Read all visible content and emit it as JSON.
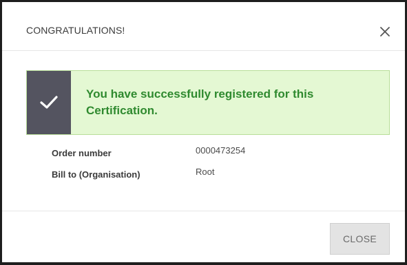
{
  "dialog": {
    "title": "CONGRATULATIONS!",
    "close_icon": "close-icon"
  },
  "alert": {
    "icon": "checkmark-icon",
    "message": "You have successfully registered for this Certification.",
    "colors": {
      "background": "#e4f8d3",
      "border": "#b8de99",
      "text": "#2f8a2f",
      "icon_bg": "#545460"
    }
  },
  "details": {
    "order_number": {
      "label": "Order number",
      "value": "0000473254"
    },
    "bill_to": {
      "label": "Bill to (Organisation)",
      "value": "Root"
    }
  },
  "footer": {
    "close_label": "CLOSE"
  }
}
